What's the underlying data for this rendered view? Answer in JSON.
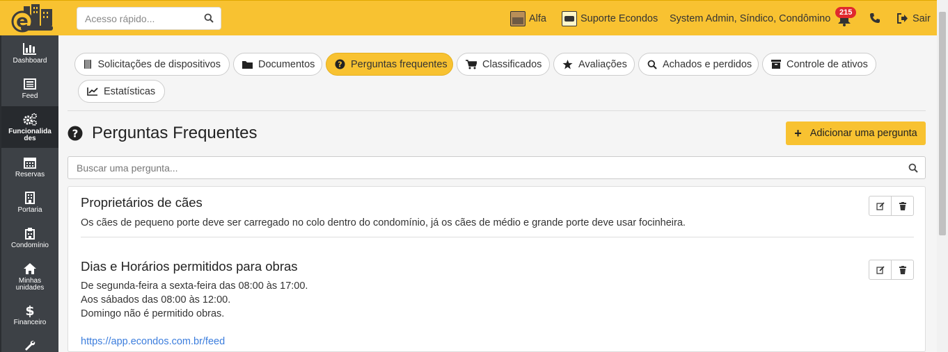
{
  "header": {
    "search_placeholder": "Acesso rápido...",
    "condo_name": "Alfa",
    "support_label": "Suporte Econdos",
    "user_roles": "System Admin, Síndico, Condômino",
    "notification_count": "215",
    "logout_label": "Sair",
    "brand_color": "#f8c231"
  },
  "sidebar": {
    "items": [
      {
        "label": "Dashboard",
        "icon": "bar-chart-icon"
      },
      {
        "label": "Feed",
        "icon": "newspaper-icon"
      },
      {
        "label_line1": "Funcionalida",
        "label_line2": "des",
        "icon": "gears-icon"
      },
      {
        "label": "Reservas",
        "icon": "calendar-icon"
      },
      {
        "label": "Portaria",
        "icon": "building-icon"
      },
      {
        "label": "Condomínio",
        "icon": "hospital-building-icon"
      },
      {
        "label_line1": "Minhas",
        "label_line2": "unidades",
        "icon": "home-icon"
      },
      {
        "label": "Financeiro",
        "icon": "dollar-icon"
      },
      {
        "icon": "wrench-icon"
      }
    ]
  },
  "tabs": [
    {
      "label": "Solicitações de dispositivos",
      "icon": "device-icon"
    },
    {
      "label": "Documentos",
      "icon": "folder-icon"
    },
    {
      "label": "Perguntas frequentes",
      "icon": "question-circle-icon"
    },
    {
      "label": "Classificados",
      "icon": "cart-icon"
    },
    {
      "label": "Avaliações",
      "icon": "star-icon"
    },
    {
      "label": "Achados e perdidos",
      "icon": "search-icon"
    },
    {
      "label": "Controle de ativos",
      "icon": "archive-icon"
    },
    {
      "label": "Estatísticas",
      "icon": "line-chart-icon"
    }
  ],
  "page": {
    "title": "Perguntas Frequentes",
    "add_button": "Adicionar uma pergunta",
    "search_placeholder": "Buscar uma pergunta..."
  },
  "faqs": [
    {
      "title": "Proprietários de cães",
      "lines": [
        "Os cães de pequeno porte deve ser carregado no colo dentro do condomínio, já os cães de médio e grande porte deve usar focinheira."
      ]
    },
    {
      "title": "Dias e Horários permitidos para obras",
      "lines": [
        "De segunda-feira a sexta-feira das 08:00 às 17:00.",
        "Aos sábados das 08:00 às 12:00.",
        "Domingo não é permitido obras."
      ],
      "link": "https://app.econdos.com.br/feed"
    }
  ]
}
